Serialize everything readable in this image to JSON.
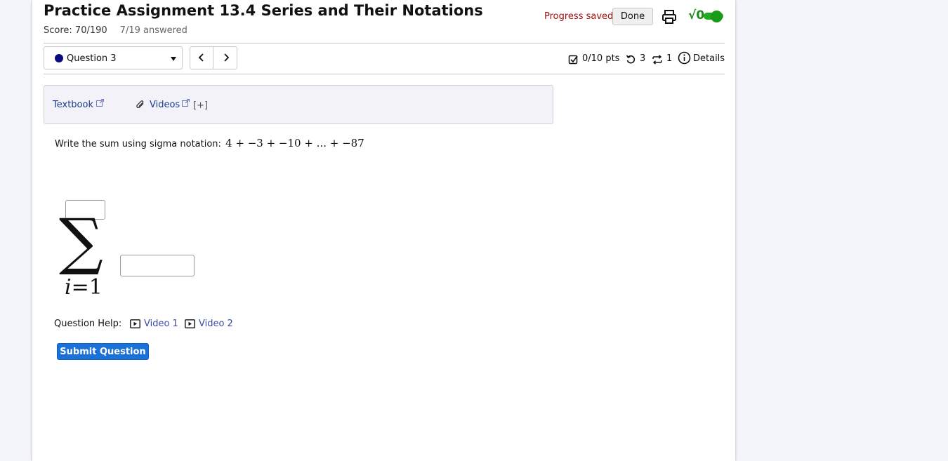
{
  "header": {
    "title": "Practice Assignment 13.4 Series and Their Notations",
    "score": "Score: 70/190",
    "answered": "7/19 answered",
    "progress_status": "Progress saved",
    "done_label": "Done",
    "math_toggle_label": "√0",
    "math_toggle_on": true
  },
  "question_nav": {
    "selected_question": "Question 3",
    "points": "0/10 pts",
    "retries": "3",
    "attempts": "1",
    "details_label": "Details"
  },
  "resources": {
    "textbook_label": "Textbook",
    "videos_label": "Videos",
    "expand_label": "[+]"
  },
  "question": {
    "prompt": "Write the sum using sigma notation:",
    "expression": "4 + −3 + −10 + ... + −87",
    "sigma_symbol": "∑",
    "lower_index": "i",
    "lower_value": "=1",
    "upper_limit_value": "",
    "term_value": ""
  },
  "help": {
    "label": "Question Help:",
    "videos": [
      "Video 1",
      "Video 2"
    ]
  },
  "submit_label": "Submit Question",
  "colors": {
    "progress_saved": "#a01010",
    "toggle_green": "#1faa1f",
    "submit_blue": "#1a72d8",
    "link_blue": "#1a3c8a"
  }
}
